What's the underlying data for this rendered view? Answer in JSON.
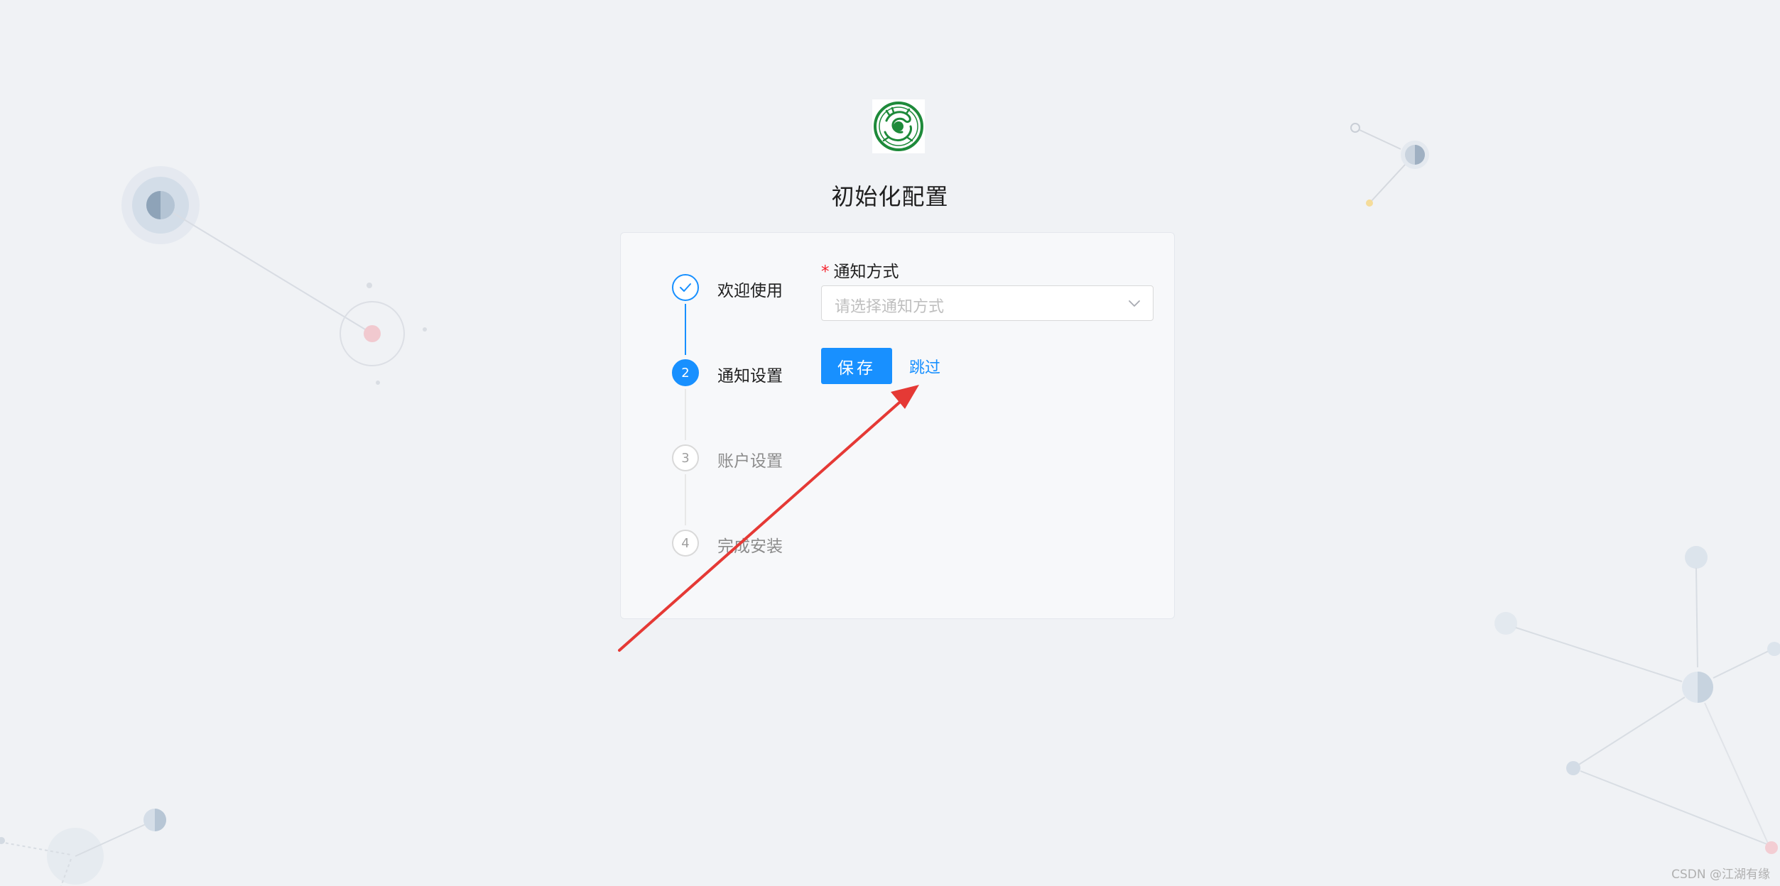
{
  "page": {
    "title": "初始化配置"
  },
  "logo": {
    "icon": "dragon-emblem",
    "color": "#1e8a3a"
  },
  "steps": [
    {
      "number": "1",
      "label": "欢迎使用",
      "status": "done"
    },
    {
      "number": "2",
      "label": "通知设置",
      "status": "active"
    },
    {
      "number": "3",
      "label": "账户设置",
      "status": "wait"
    },
    {
      "number": "4",
      "label": "完成安装",
      "status": "wait"
    }
  ],
  "form": {
    "notify": {
      "required_mark": "*",
      "label": "通知方式",
      "placeholder": "请选择通知方式",
      "value": ""
    },
    "save_label": "保存",
    "skip_label": "跳过"
  },
  "watermark": "CSDN @江湖有缘",
  "colors": {
    "primary": "#1890ff",
    "required": "#f5222d",
    "background": "#f0f2f5",
    "arrow": "#e53935"
  }
}
